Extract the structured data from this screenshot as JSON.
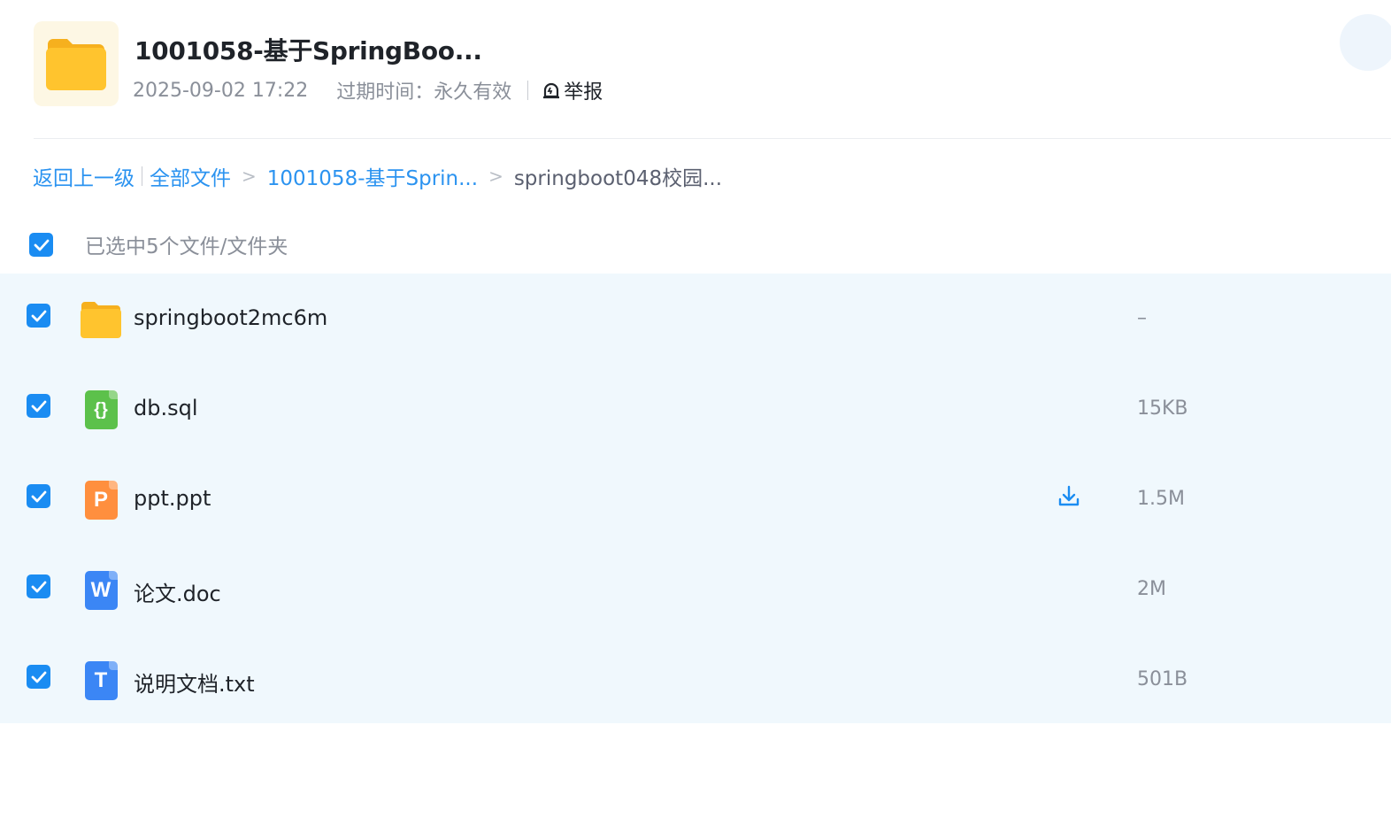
{
  "header": {
    "title": "1001058-基于SpringBoo...",
    "date": "2025-09-02 17:22",
    "expire_label": "过期时间：永久有效",
    "report_label": "举报"
  },
  "breadcrumb": {
    "back": "返回上一级",
    "all_files": "全部文件",
    "gt": ">",
    "level1": "1001058-基于Sprin...",
    "current": "springboot048校园..."
  },
  "selection": {
    "label": "已选中5个文件/文件夹"
  },
  "files": [
    {
      "name": "springboot2mc6m",
      "size": "–",
      "icon": "folder-icon"
    },
    {
      "name": "db.sql",
      "size": "15KB",
      "icon": "sql-file-icon",
      "glyph": "{}"
    },
    {
      "name": "ppt.ppt",
      "size": "1.5M",
      "icon": "ppt-file-icon",
      "glyph": "P"
    },
    {
      "name": "论文.doc",
      "size": "2M",
      "icon": "word-file-icon",
      "glyph": "W"
    },
    {
      "name": "说明文档.txt",
      "size": "501B",
      "icon": "txt-file-icon",
      "glyph": "T"
    }
  ],
  "colors": {
    "accent": "#1a8cf2",
    "list_bg": "#f0f8fd",
    "folder": "#ffc42e",
    "sql": "#5cc14b",
    "ppt": "#ff8f3e",
    "word": "#3b86f5",
    "txt": "#3b86f5"
  }
}
